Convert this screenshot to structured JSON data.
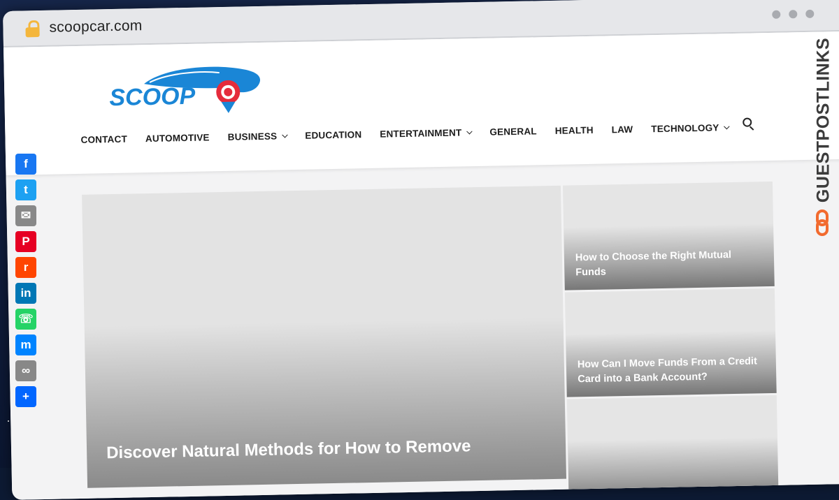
{
  "browser": {
    "url": "scoopcar.com"
  },
  "site": {
    "logo_text": "SCOOP",
    "brand_color": "#1a86d6",
    "accent_color": "#e52b3b"
  },
  "nav": {
    "items": [
      {
        "label": "CONTACT",
        "dropdown": false
      },
      {
        "label": "AUTOMOTIVE",
        "dropdown": false
      },
      {
        "label": "BUSINESS",
        "dropdown": true
      },
      {
        "label": "EDUCATION",
        "dropdown": false
      },
      {
        "label": "ENTERTAINMENT",
        "dropdown": true
      },
      {
        "label": "GENERAL",
        "dropdown": false
      },
      {
        "label": "HEALTH",
        "dropdown": false
      },
      {
        "label": "LAW",
        "dropdown": false
      },
      {
        "label": "TECHNOLOGY",
        "dropdown": true
      }
    ],
    "search_icon": "search-icon"
  },
  "featured": {
    "main": {
      "title": "Discover Natural Methods for How to Remove"
    },
    "side": [
      {
        "title": "How to Choose the Right Mutual Funds"
      },
      {
        "title": "How Can I Move Funds From a Credit Card into a Bank Account?"
      },
      {
        "title": ""
      }
    ]
  },
  "share": [
    {
      "icon": "facebook-icon",
      "glyph": "f",
      "color": "#1877f2"
    },
    {
      "icon": "twitter-icon",
      "glyph": "t",
      "color": "#1da1f2"
    },
    {
      "icon": "email-icon",
      "glyph": "✉",
      "color": "#888888"
    },
    {
      "icon": "pinterest-icon",
      "glyph": "P",
      "color": "#e60023"
    },
    {
      "icon": "reddit-icon",
      "glyph": "r",
      "color": "#ff4500"
    },
    {
      "icon": "linkedin-icon",
      "glyph": "in",
      "color": "#0077b5"
    },
    {
      "icon": "whatsapp-icon",
      "glyph": "☏",
      "color": "#25d366"
    },
    {
      "icon": "messenger-icon",
      "glyph": "m",
      "color": "#0084ff"
    },
    {
      "icon": "copy-link-icon",
      "glyph": "∞",
      "color": "#888888"
    },
    {
      "icon": "share-icon",
      "glyph": "+",
      "color": "#0166ff"
    }
  ],
  "watermark": {
    "text": "GUESTPOSTLINKS",
    "color": "#f26a2e"
  }
}
